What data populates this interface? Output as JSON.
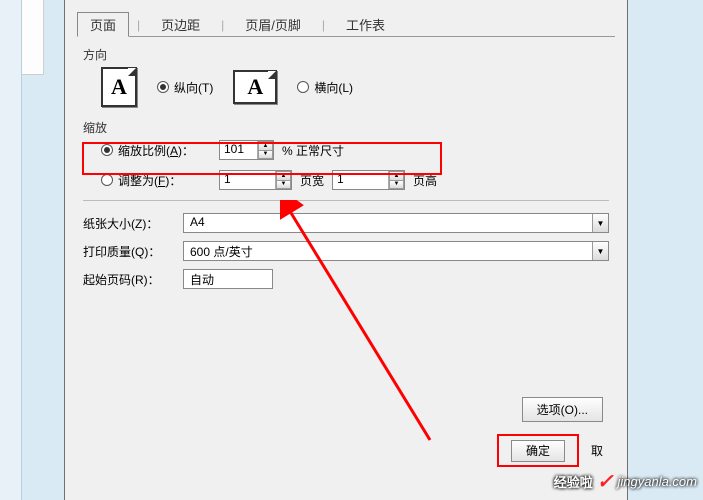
{
  "tabs": {
    "page": "页面",
    "margins": "页边距",
    "header_footer": "页眉/页脚",
    "sheet": "工作表"
  },
  "direction": {
    "label": "方向",
    "portrait": "纵向(T)",
    "landscape": "横向(L)",
    "icon_letter": "A"
  },
  "zoom": {
    "label": "缩放",
    "scale_label_pre": "缩放比例(",
    "scale_label_key": "A",
    "scale_label_post": ")：",
    "scale_value": "101",
    "scale_suffix": "% 正常尺寸",
    "fit_label_pre": "调整为(",
    "fit_label_key": "F",
    "fit_label_post": ")：",
    "fit_wide_value": "1",
    "fit_wide_suffix": "页宽",
    "fit_tall_value": "1",
    "fit_tall_suffix": "页高"
  },
  "paper": {
    "size_label": "纸张大小(Z)：",
    "size_value": "A4",
    "quality_label": "打印质量(Q)：",
    "quality_value": "600 点/英寸",
    "first_page_label": "起始页码(R)：",
    "first_page_value": "自动"
  },
  "buttons": {
    "options": "选项(O)...",
    "ok": "确定",
    "cancel": "取"
  },
  "watermark": {
    "logo": "经验啦",
    "site": "jingyanla.com",
    "check": "✓"
  }
}
